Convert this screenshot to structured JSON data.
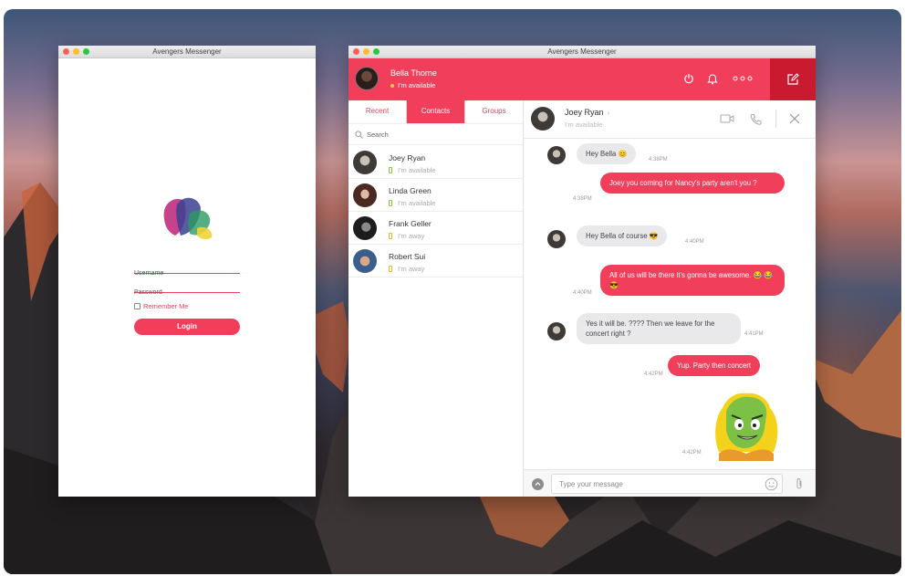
{
  "login_window": {
    "title": "Avengers Messenger",
    "username_placeholder": "Username",
    "password_placeholder": "Password",
    "remember_label": "Remember Me",
    "login_label": "Login"
  },
  "messenger_window": {
    "title": "Avengers Messenger",
    "current_user": {
      "name": "Bella Thorne",
      "status": "I'm available"
    },
    "header_icons": [
      "power-icon",
      "bell-icon",
      "more-icon",
      "compose-icon"
    ],
    "tabs": [
      {
        "label": "Recent",
        "active": false
      },
      {
        "label": "Contacts",
        "active": true
      },
      {
        "label": "Groups",
        "active": false
      }
    ],
    "search_placeholder": "Search",
    "contacts": [
      {
        "name": "Joey Ryan",
        "status": "I'm available"
      },
      {
        "name": "Linda Green",
        "status": "I'm available"
      },
      {
        "name": "Frank Geller",
        "status": "I'm away"
      },
      {
        "name": "Robert Sui",
        "status": "I'm away"
      }
    ],
    "chat": {
      "contact_name": "Joey Ryan",
      "contact_status": "I'm available",
      "messages": [
        {
          "direction": "in",
          "text": "Hey Bella 😊",
          "time": "4:38PM"
        },
        {
          "direction": "out",
          "text": "Joey you coming for Nancy's party aren't you ?",
          "time": "4:38PM"
        },
        {
          "direction": "in",
          "text": "Hey Bella of course 😎",
          "time": "4:40PM"
        },
        {
          "direction": "out",
          "text": "All of us will be there it's gonna be awesome. 😂 😂 😎",
          "time": "4:40PM"
        },
        {
          "direction": "in",
          "text": "Yes it will be. ???? Then we leave for the concert right ?",
          "time": "4:41PM"
        },
        {
          "direction": "out",
          "text": "Yup. Party then concert",
          "time": "4:42PM"
        },
        {
          "direction": "out",
          "type": "sticker",
          "time": "4:42PM"
        }
      ],
      "input_placeholder": "Type your message"
    }
  },
  "colors": {
    "accent": "#f03e5b",
    "accent_dark": "#c91a30"
  }
}
